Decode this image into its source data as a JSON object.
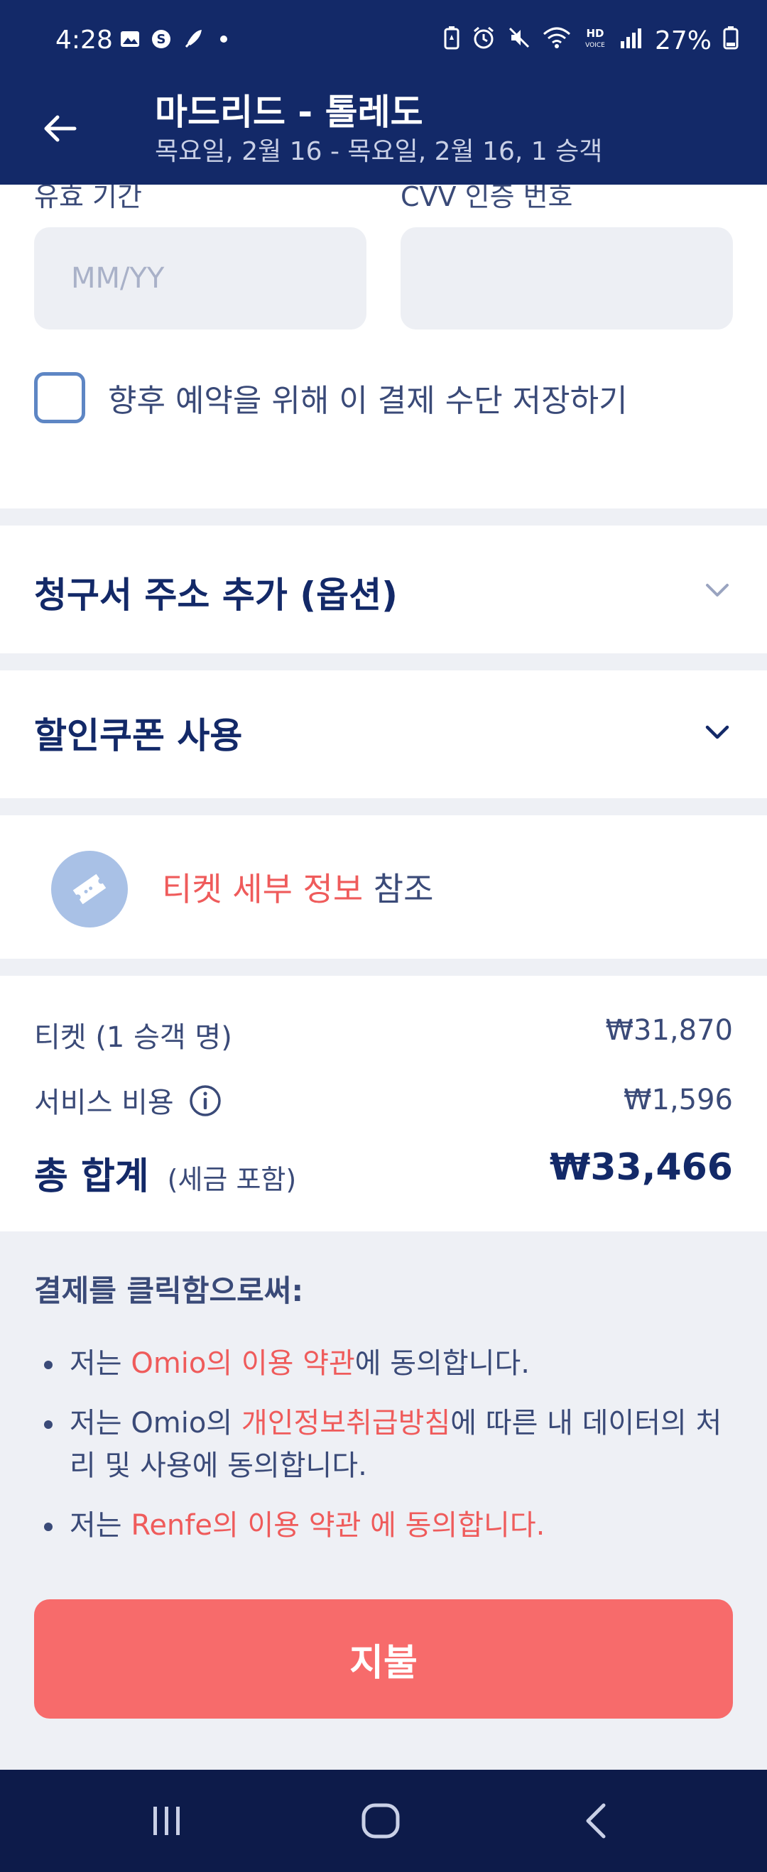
{
  "status_bar": {
    "time": "4:28",
    "battery": "27%",
    "left_icons": [
      "gallery-icon",
      "s-icon",
      "feather-icon",
      "dot-icon"
    ],
    "right_icons": [
      "battery-saver-icon",
      "alarm-icon",
      "mute-icon",
      "wifi-icon",
      "hd-voice-icon",
      "signal-icon",
      "battery-icon"
    ]
  },
  "header": {
    "title": "마드리드 - 톨레도",
    "subtitle": "목요일, 2월 16 - 목요일, 2월 16, 1 승객"
  },
  "card_form": {
    "expiry_label": "유효 기간",
    "expiry_placeholder": "MM/YY",
    "cvv_label": "CVV 인증 번호",
    "cvv_placeholder": "",
    "save_checkbox_label": "향후 예약을 위해 이 결제 수단 저장하기"
  },
  "billing_address": {
    "title": "청구서 주소 추가 (옵션)"
  },
  "coupon": {
    "title": "할인쿠폰 사용"
  },
  "ticket_details": {
    "link_text": "티켓 세부 정보",
    "suffix": " 참조"
  },
  "price": {
    "ticket_label": "티켓 (1 승객 명)",
    "ticket_value": "₩31,870",
    "service_label": "서비스 비용",
    "service_value": "₩1,596",
    "total_label": "총 합계",
    "total_note": "(세금 포함)",
    "total_value": "₩33,466"
  },
  "terms": {
    "title": "결제를 클릭함으로써:",
    "item1": {
      "pre": "저는 ",
      "link": "Omio의 이용 약관",
      "post": "에 동의합니다."
    },
    "item2": {
      "pre": "저는 Omio의 ",
      "link": "개인정보취급방침",
      "post": "에 따른 내 데이터의 처리 및 사용에 동의합니다."
    },
    "item3": {
      "pre": "저는 ",
      "link": "Renfe의 이용 약관 에 동의합니다.",
      "post": ""
    }
  },
  "pay_button": {
    "label": "지불"
  },
  "colors": {
    "navy": "#132968",
    "accent_red": "#f76b6b",
    "link_red": "#ef5b5b",
    "background": "#eef0f5"
  }
}
